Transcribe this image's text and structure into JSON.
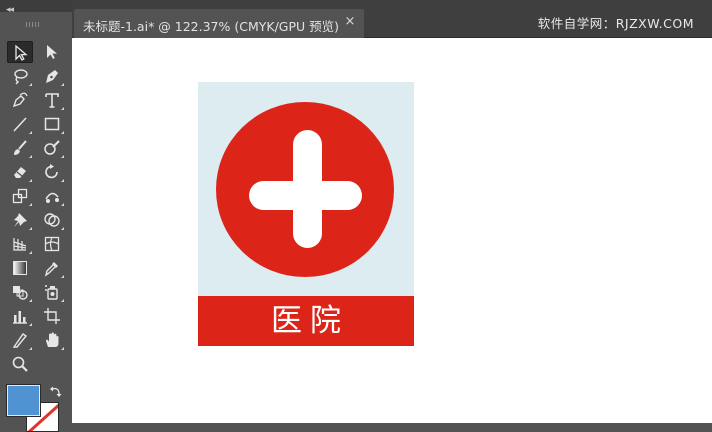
{
  "document_tab": {
    "title": "未标题-1.ai* @ 122.37% (CMYK/GPU 预览)",
    "close_symbol": "×"
  },
  "watermark": "软件自学网：RJZXW.COM",
  "toolbar": {
    "collapse_symbol": "◂◂",
    "tools": [
      "selection-tool",
      "direct-selection-tool",
      "magic-wand-tool",
      "pen-tool",
      "curvature-tool",
      "type-tool",
      "line-segment-tool",
      "rectangle-tool",
      "paintbrush-tool",
      "shaper-tool",
      "eraser-tool",
      "rotate-tool",
      "scale-tool",
      "puppet-warp-tool",
      "pin-tool",
      "shape-builder-tool",
      "perspective-grid-tool",
      "mesh-tool",
      "gradient-tool",
      "eyedropper-tool",
      "blend-tool",
      "symbol-sprayer-tool",
      "column-graph-tool",
      "artboard-tool",
      "slice-tool",
      "hand-tool",
      "zoom-tool"
    ],
    "fill_color": "#4f93d3",
    "stroke_color": "none"
  },
  "artwork": {
    "label": "医院",
    "background_color": "#dcecf1",
    "accent_color": "#dc2518",
    "symbol": "cross-in-circle"
  }
}
